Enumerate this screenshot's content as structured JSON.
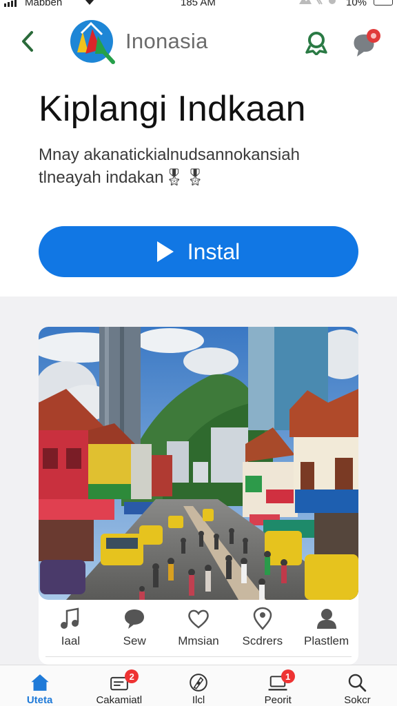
{
  "status_bar": {
    "carrier": "Mabben",
    "time": "185 AM",
    "battery": "10%"
  },
  "header": {
    "brand": "Inonasia",
    "back_icon": "chevron-left-icon",
    "award_icon": "award-ribbon-icon",
    "chat_icon": "chat-bubble-icon",
    "accent_color": "#2aa060"
  },
  "app": {
    "title": "Kiplangi Indkaan",
    "description_line1": "Mnay akanatickialnudsannokansiah",
    "description_line2": "tlneayah indakan",
    "description_emoji": "🎖🎖",
    "install_label": "Instal",
    "install_color": "#1177e4"
  },
  "card": {
    "photo_alt": "street-market-scene",
    "actions": [
      {
        "label": "Iaal",
        "icon": "music-note-icon"
      },
      {
        "label": "Sew",
        "icon": "speech-bubble-icon"
      },
      {
        "label": "Mmsian",
        "icon": "heart-icon"
      },
      {
        "label": "Scdrers",
        "icon": "location-pin-icon"
      },
      {
        "label": "Plastlem",
        "icon": "person-icon"
      }
    ]
  },
  "tab_bar": {
    "tabs": [
      {
        "label": "Uteta",
        "icon": "home-icon",
        "active": true
      },
      {
        "label": "Cakamiatl",
        "icon": "messages-icon",
        "badge": "2"
      },
      {
        "label": "Ilcl",
        "icon": "explore-icon"
      },
      {
        "label": "Peorit",
        "icon": "laptop-icon",
        "badge": "1"
      },
      {
        "label": "Sokcr",
        "icon": "search-icon"
      }
    ]
  }
}
